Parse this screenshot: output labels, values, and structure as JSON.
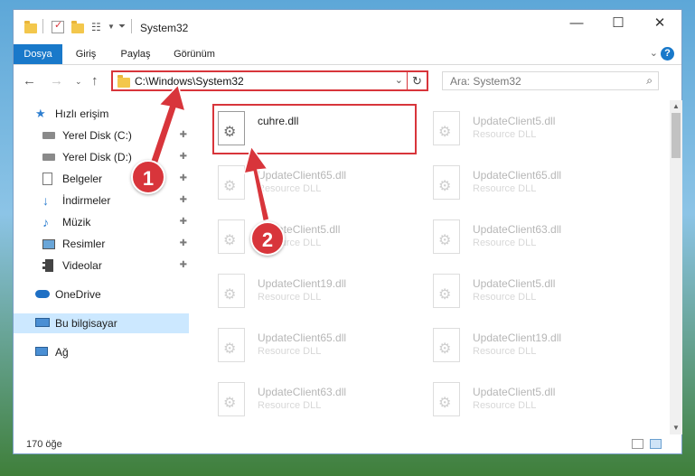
{
  "window": {
    "title": "System32",
    "controls": {
      "minimize": "—",
      "maximize": "☐",
      "close": "✕"
    }
  },
  "ribbon": {
    "tabs": [
      "Dosya",
      "Giriş",
      "Paylaş",
      "Görünüm"
    ],
    "active_tab": "Dosya",
    "help": "?"
  },
  "nav": {
    "back_icon": "arrow-left-icon",
    "forward_icon": "arrow-right-icon",
    "up_icon": "arrow-up-icon",
    "address": "C:\\Windows\\System32",
    "search_placeholder": "Ara: System32"
  },
  "sidebar": {
    "items": [
      {
        "label": "Hızlı erişim",
        "icon": "star-icon",
        "pinned": false
      },
      {
        "label": "Yerel Disk (C:)",
        "icon": "drive-icon",
        "pinned": true
      },
      {
        "label": "Yerel Disk (D:)",
        "icon": "drive-icon",
        "pinned": true
      },
      {
        "label": "Belgeler",
        "icon": "documents-icon",
        "pinned": true
      },
      {
        "label": "İndirmeler",
        "icon": "download-icon",
        "pinned": true
      },
      {
        "label": "Müzik",
        "icon": "music-icon",
        "pinned": true
      },
      {
        "label": "Resimler",
        "icon": "pictures-icon",
        "pinned": true
      },
      {
        "label": "Videolar",
        "icon": "videos-icon",
        "pinned": true
      },
      {
        "label": "OneDrive",
        "icon": "cloud-icon",
        "pinned": false
      },
      {
        "label": "Bu bilgisayar",
        "icon": "computer-icon",
        "pinned": false
      },
      {
        "label": "Ağ",
        "icon": "network-icon",
        "pinned": false
      }
    ],
    "pin_glyph": "📌"
  },
  "files": {
    "left_column": [
      {
        "name": "cuhre.dll",
        "type": ""
      },
      {
        "name": "UpdateClient65.dll",
        "type": "Resource DLL"
      },
      {
        "name": "UpdateClient5.dll",
        "type": "Resource DLL"
      },
      {
        "name": "UpdateClient19.dll",
        "type": "Resource DLL"
      },
      {
        "name": "UpdateClient65.dll",
        "type": "Resource DLL"
      },
      {
        "name": "UpdateClient63.dll",
        "type": "Resource DLL"
      }
    ],
    "right_column": [
      {
        "name": "UpdateClient5.dll",
        "type": "Resource DLL"
      },
      {
        "name": "UpdateClient65.dll",
        "type": "Resource DLL"
      },
      {
        "name": "UpdateClient63.dll",
        "type": "Resource DLL"
      },
      {
        "name": "UpdateClient5.dll",
        "type": "Resource DLL"
      },
      {
        "name": "UpdateClient19.dll",
        "type": "Resource DLL"
      },
      {
        "name": "UpdateClient5.dll",
        "type": "Resource DLL"
      }
    ]
  },
  "status": {
    "item_count": "170 öğe"
  },
  "annotations": {
    "badge1": "1",
    "badge2": "2",
    "accent": "#d8353b"
  }
}
